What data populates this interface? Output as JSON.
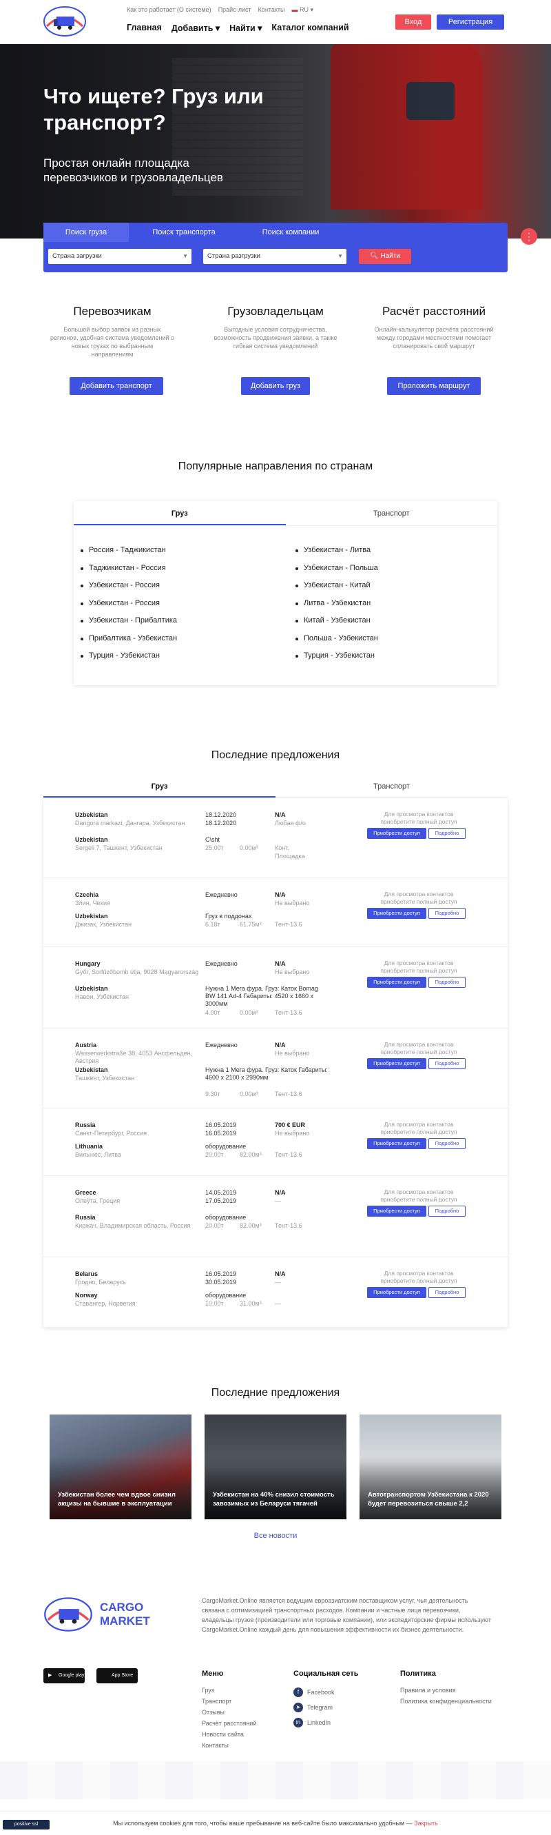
{
  "header": {
    "top_links": [
      "Как это работает (О системе)",
      "Прайс-лист",
      "Контакты",
      "RU"
    ],
    "nav": [
      "Главная",
      "Добавить",
      "Найти",
      "Каталог компаний"
    ],
    "login": "Вход",
    "register": "Регистрация"
  },
  "hero": {
    "title": "Что ищете? Груз или транспорт?",
    "subtitle": "Простая онлайн площадка перевозчиков и грузовладельцев"
  },
  "search": {
    "tabs": [
      "Поиск груза",
      "Поиск транспорта",
      "Поиск компании"
    ],
    "from_placeholder": "Страна загрузки",
    "to_placeholder": "Страна разгрузки",
    "find": "Найти"
  },
  "features": [
    {
      "title": "Перевозчикам",
      "text": "Большой выбор заявок из разных регионов, удобная система уведомлений о новых грузах по выбранным направлениям",
      "button": "Добавить транспорт"
    },
    {
      "title": "Грузовладельцам",
      "text": "Выгодные условия сотрудничества, возможность продвижения заявки, а также гибкая система уведомлений",
      "button": "Добавить груз"
    },
    {
      "title": "Расчёт расстояний",
      "text": "Онлайн-калькулятор расчёта расстояний между городами местностями помогает спланировать свой маршрут",
      "button": "Проложить маршрут"
    }
  ],
  "popular": {
    "title": "Популярные направления по странам",
    "tabs": [
      "Груз",
      "Транспорт"
    ],
    "left": [
      "Россия - Таджикистан",
      "Таджикистан - Россия",
      "Узбекистан - Россия",
      "Узбекистан - Россия",
      "Узбекистан - Прибалтика",
      "Прибалтика - Узбекистан",
      "Турция - Узбекистан"
    ],
    "right": [
      "Узбекистан - Литва",
      "Узбекистан - Польша",
      "Узбекистан - Китай",
      "Литва - Узбекистан",
      "Китай - Узбекистан",
      "Польша - Узбекистан",
      "Турция - Узбекистан"
    ]
  },
  "offers": {
    "title": "Последние предложения",
    "tabs": [
      "Груз",
      "Транспорт"
    ],
    "note": "Для просмотра контактов приобретите полный доступ",
    "buy": "Приобрести доступ",
    "more": "Подробно",
    "rows": [
      {
        "from": "Uzbekistan",
        "from_addr": "Dangora markazi, Дангара, Узбекистан",
        "to": "Uzbekistan",
        "to_addr": "Sergeli 7, Ташкент, Узбекистан",
        "date1": "18.12.2020",
        "date2": "18.12.2020",
        "cargo": "C\\sht",
        "weight": "25.00т",
        "volume": "0.00м³",
        "price": "N/A",
        "extra1": "Любая ф/о",
        "extra2": "Конт.",
        "extra3": "Площадка"
      },
      {
        "from": "Czechia",
        "from_addr": "Злин, Чехия",
        "to": "Uzbekistan",
        "to_addr": "Джизак, Узбекистан",
        "date1": "Ежедневно",
        "date2": "",
        "cargo": "Груз в поддонах",
        "weight": "6.18т",
        "volume": "61.75м³",
        "price": "N/A",
        "extra1": "Не выбрано",
        "extra2": "Тент-13.6",
        "extra3": ""
      },
      {
        "from": "Hungary",
        "from_addr": "Győr, Sorfűzőbomb útja, 9028 Magyarország",
        "to": "Uzbekistan",
        "to_addr": "Навои, Узбекистан",
        "date1": "Ежедневно",
        "date2": "",
        "cargo": "Нужна 1 Мега фура. Груз: Каток Bomag BW 141 Ad-4 Габариты: 4520 х 1660 х 3000мм",
        "weight": "4.00т",
        "volume": "0.00м³",
        "price": "N/A",
        "extra1": "Не выбрано",
        "extra2": "Тент-13.6",
        "extra3": ""
      },
      {
        "from": "Austria",
        "from_addr": "Wasserwerkstraße 38, 4053 Ансфельден, Австрия",
        "to": "Uzbekistan",
        "to_addr": "Ташкент, Узбекистан",
        "date1": "Ежедневно",
        "date2": "",
        "cargo": "Нужна 1 Мега фура. Груз: Каток Габариты: 4600 х 2100 х 2990мм",
        "weight": "9.30т",
        "volume": "0.00м³",
        "price": "N/A",
        "extra1": "Не выбрано",
        "extra2": "Тент-13.6",
        "extra3": ""
      },
      {
        "from": "Russia",
        "from_addr": "Санкт-Петербург, Россия",
        "to": "Lithuania",
        "to_addr": "Вильнюс, Литва",
        "date1": "16.05.2019",
        "date2": "16.05.2019",
        "cargo": "оборудование",
        "weight": "20.00т",
        "volume": "82.00м³",
        "price": "700 € EUR",
        "extra1": "Не выбрано",
        "extra2": "Тент-13.6",
        "extra3": ""
      },
      {
        "from": "Greece",
        "from_addr": "Олеўта, Греция",
        "to": "Russia",
        "to_addr": "Киржач, Владимирская область, Россия",
        "date1": "14.05.2019",
        "date2": "17.05.2019",
        "cargo": "оборудование",
        "weight": "20.00т",
        "volume": "82.00м³",
        "price": "N/A",
        "extra1": "—",
        "extra2": "Тент-13.6",
        "extra3": ""
      },
      {
        "from": "Belarus",
        "from_addr": "Гродно, Беларусь",
        "to": "Norway",
        "to_addr": "Ставангер, Норвегия",
        "date1": "16.05.2019",
        "date2": "30.05.2019",
        "cargo": "оборудование",
        "weight": "10.00т",
        "volume": "31.00м³",
        "price": "N/A",
        "extra1": "—",
        "extra2": "—",
        "extra3": ""
      }
    ]
  },
  "news": {
    "title": "Последние предложения",
    "items": [
      "Узбекистан более чем вдвое снизил акцизы на бывшие в эксплуатации",
      "Узбекистан на 40% снизил стоимость завозимых из Беларуси тягачей",
      "Автотранспортом Узбекистана к 2020 будет перевозиться свыше 2,2"
    ],
    "all": "Все новости"
  },
  "footer": {
    "brand": "CARGO MARKET",
    "about": "CargoMarket.Online является ведущим евроазиатским поставщиком услуг, чья деятельность связана с оптимизацией транспортных расходов. Компании и частные лица перевозчики, владельцы грузов (производители или торговые компании), или экспедиторские фирмы используют CargoMarket.Online каждый день для повышения эффективности их бизнес деятельности.",
    "google_play": "Google play",
    "app_store": "App Store",
    "menu_title": "Меню",
    "menu": [
      "Груз",
      "Транспорт",
      "Отзывы",
      "Расчёт расстояний",
      "Новости сайта",
      "Контакты"
    ],
    "social_title": "Социальная сеть",
    "social": [
      "Facebook",
      "Telegram",
      "LinkedIn"
    ],
    "policy_title": "Политика",
    "policy": [
      "Правила и условия",
      "Политика конфиденциальности"
    ]
  },
  "cookie": {
    "text": "Мы используем cookies для того, чтобы ваше пребывание на веб-сайте было максимально удобным —",
    "close": "Закрыть"
  },
  "badge": "positive ssl",
  "colors": {
    "primary": "#3f51e0",
    "accent": "#ef4c56"
  }
}
